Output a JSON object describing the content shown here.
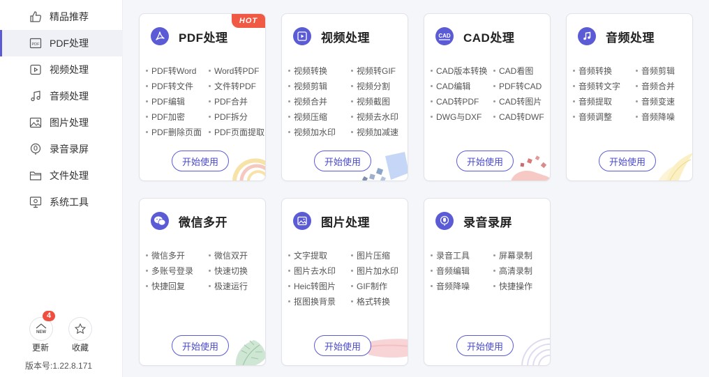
{
  "sidebar": {
    "items": [
      {
        "label": "精品推荐",
        "icon": "thumb-up-icon"
      },
      {
        "label": "PDF处理",
        "icon": "pdf-icon"
      },
      {
        "label": "视频处理",
        "icon": "video-icon"
      },
      {
        "label": "音频处理",
        "icon": "music-icon"
      },
      {
        "label": "图片处理",
        "icon": "image-icon"
      },
      {
        "label": "录音录屏",
        "icon": "record-icon"
      },
      {
        "label": "文件处理",
        "icon": "folder-icon"
      },
      {
        "label": "系统工具",
        "icon": "monitor-icon"
      }
    ],
    "update_label": "更新",
    "update_badge": "4",
    "update_icon_text": "NEW",
    "favorite_label": "收藏",
    "version": "版本号:1.22.8.171"
  },
  "cards": [
    {
      "title": "PDF处理",
      "hot": "HOT",
      "features": [
        "PDF转Word",
        "Word转PDF",
        "PDF转文件",
        "文件转PDF",
        "PDF编辑",
        "PDF合并",
        "PDF加密",
        "PDF拆分",
        "PDF删除页面",
        "PDF页面提取"
      ],
      "button": "开始使用"
    },
    {
      "title": "视频处理",
      "features": [
        "视频转换",
        "视频转GIF",
        "视频剪辑",
        "视频分割",
        "视频合并",
        "视频截图",
        "视频压缩",
        "视频去水印",
        "视频加水印",
        "视频加减速"
      ],
      "button": "开始使用"
    },
    {
      "title": "CAD处理",
      "icon_text": "CAD",
      "features": [
        "CAD版本转换",
        "CAD看图",
        "CAD编辑",
        "PDF转CAD",
        "CAD转PDF",
        "CAD转图片",
        "DWG与DXF",
        "CAD转DWF"
      ],
      "button": "开始使用"
    },
    {
      "title": "音频处理",
      "features": [
        "音频转换",
        "音频剪辑",
        "音频转文字",
        "音频合并",
        "音频提取",
        "音频变速",
        "音频调整",
        "音频降噪"
      ],
      "button": "开始使用"
    },
    {
      "title": "微信多开",
      "features": [
        "微信多开",
        "微信双开",
        "多账号登录",
        "快速切换",
        "快捷回复",
        "极速运行"
      ],
      "button": "开始使用"
    },
    {
      "title": "图片处理",
      "features": [
        "文字提取",
        "图片压缩",
        "图片去水印",
        "图片加水印",
        "Heic转图片",
        "GIF制作",
        "抠图换背景",
        "格式转换"
      ],
      "button": "开始使用"
    },
    {
      "title": "录音录屏",
      "features": [
        "录音工具",
        "屏幕录制",
        "音频编辑",
        "高清录制",
        "音频降噪",
        "快捷操作"
      ],
      "button": "开始使用"
    }
  ],
  "colors": {
    "accent": "#5b5bd6",
    "hot": "#f05a45",
    "badge": "#f04e3e"
  }
}
